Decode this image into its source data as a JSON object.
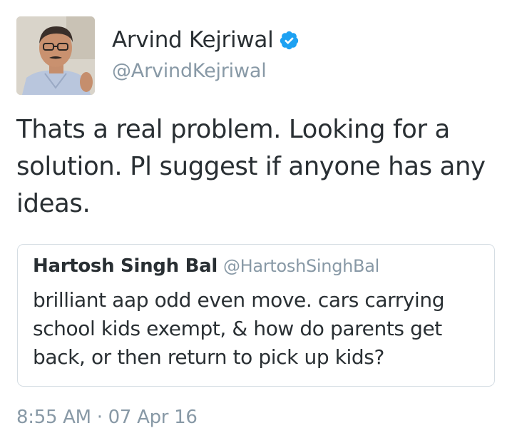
{
  "author": {
    "display_name": "Arvind Kejriwal",
    "handle": "@ArvindKejriwal",
    "verified": true,
    "avatar_icon": "profile-photo"
  },
  "tweet": {
    "text": "Thats a real problem. Looking for a solution. Pl suggest if anyone has any ideas.",
    "timestamp": "8:55 AM · 07 Apr 16"
  },
  "quoted_tweet": {
    "display_name": "Hartosh Singh Bal",
    "handle": "@HartoshSinghBal",
    "text": "brilliant aap odd even move. cars carrying school kids exempt, & how do parents get back, or then return to pick up kids?"
  },
  "colors": {
    "verified_badge": "#1da1f2",
    "secondary_text": "#8899a6",
    "primary_text": "#292f33",
    "card_border": "#d5dde3"
  }
}
